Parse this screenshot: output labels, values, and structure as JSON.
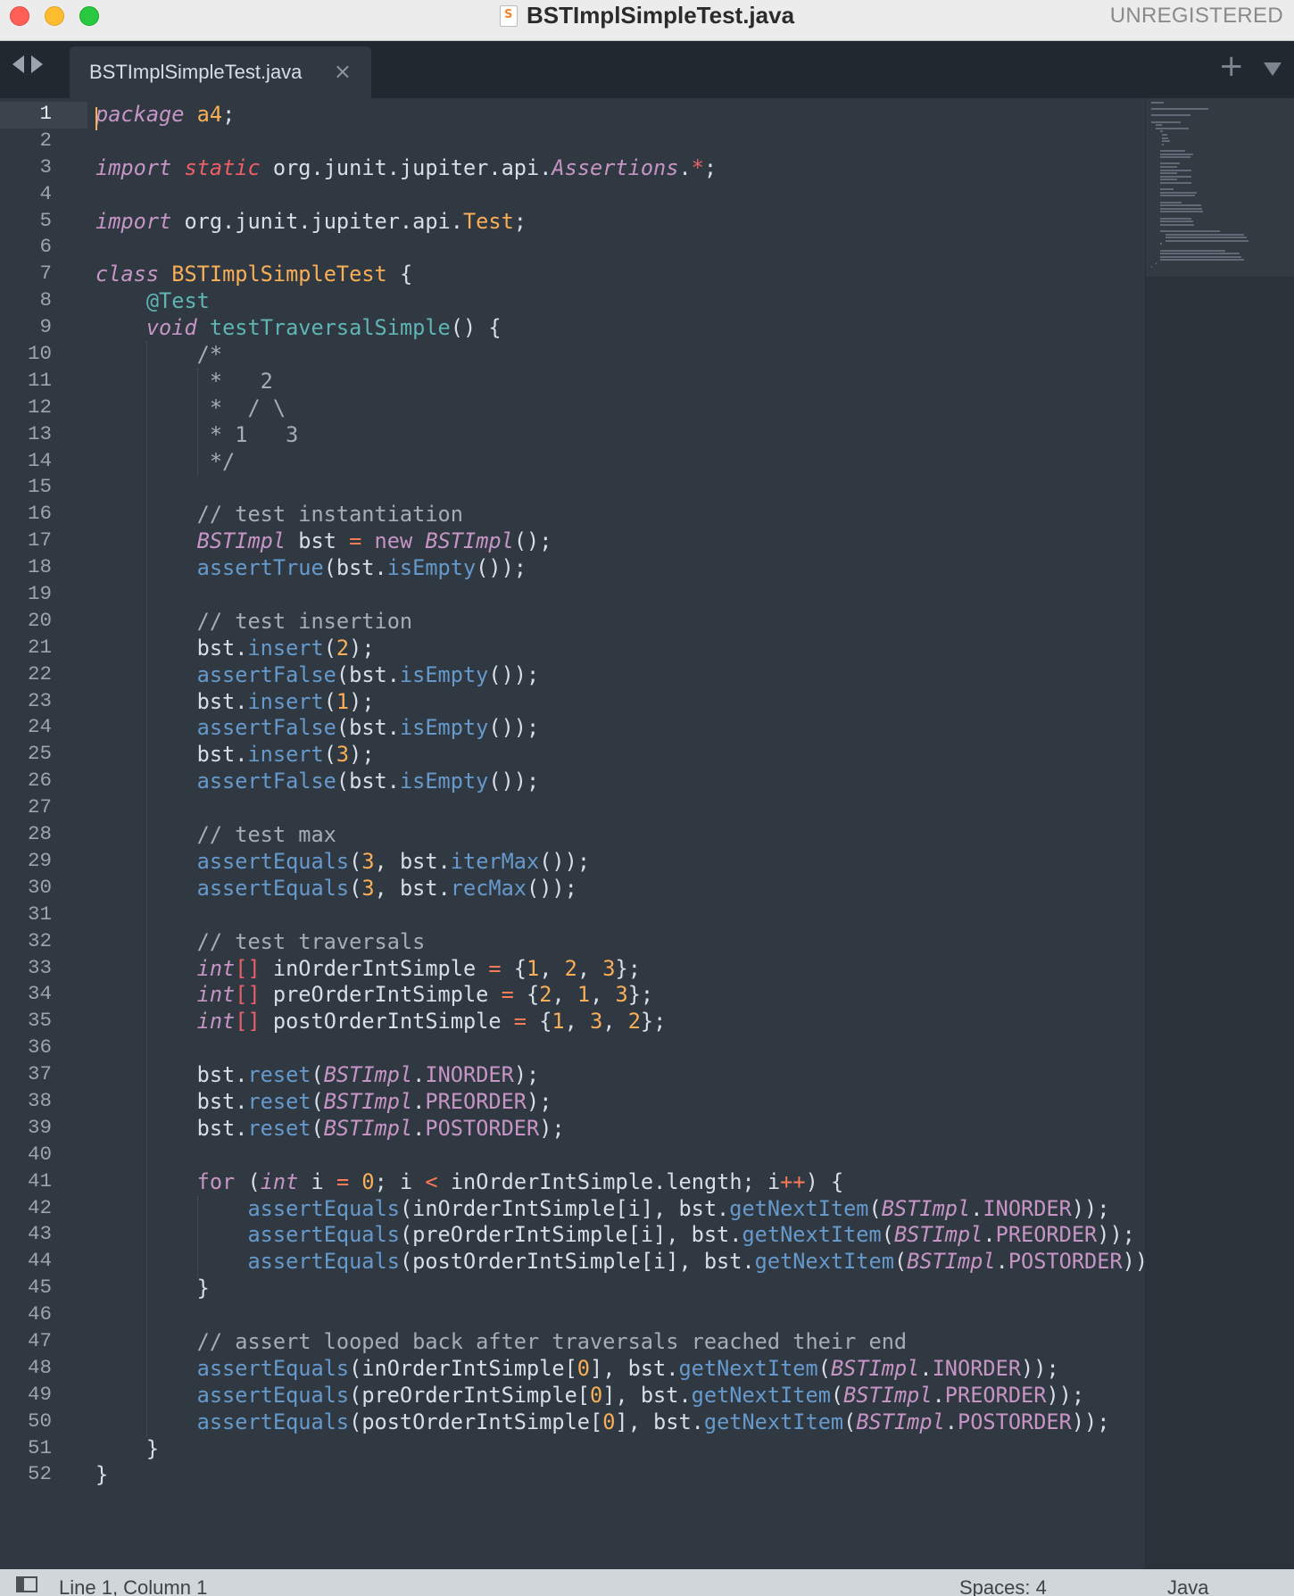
{
  "window": {
    "title": "BSTImplSimpleTest.java",
    "license_status": "UNREGISTERED",
    "file_icon": "sublime-file-icon"
  },
  "tabs": [
    {
      "label": "BSTImplSimpleTest.java",
      "active": true
    }
  ],
  "tab_bar": {
    "close_glyph": "×",
    "new_tab_glyph": "+"
  },
  "editor": {
    "current_line": 1,
    "line_numbers": [
      "1",
      "2",
      "3",
      "4",
      "5",
      "6",
      "7",
      "8",
      "9",
      "10",
      "11",
      "12",
      "13",
      "14",
      "15",
      "16",
      "17",
      "18",
      "19",
      "20",
      "21",
      "22",
      "23",
      "24",
      "25",
      "26",
      "27",
      "28",
      "29",
      "30",
      "31",
      "32",
      "33",
      "34",
      "35",
      "36",
      "37",
      "38",
      "39",
      "40",
      "41",
      "42",
      "43",
      "44",
      "45",
      "46",
      "47",
      "48",
      "49",
      "50",
      "51",
      "52"
    ],
    "lines": [
      [
        [
          "kw",
          "package"
        ],
        [
          "pu",
          " "
        ],
        [
          "ty",
          "a4"
        ],
        [
          "pu",
          ";"
        ]
      ],
      [],
      [
        [
          "kw",
          "import"
        ],
        [
          "pu",
          " "
        ],
        [
          "sc",
          "static"
        ],
        [
          "pu",
          " org.junit.jupiter.api."
        ],
        [
          "cls",
          "Assertions"
        ],
        [
          "pu",
          "."
        ],
        [
          "lt",
          "*"
        ],
        [
          "pu",
          ";"
        ]
      ],
      [],
      [
        [
          "kw",
          "import"
        ],
        [
          "pu",
          " org.junit.jupiter.api."
        ],
        [
          "ty",
          "Test"
        ],
        [
          "pu",
          ";"
        ]
      ],
      [],
      [
        [
          "kw",
          "class"
        ],
        [
          "pu",
          " "
        ],
        [
          "ty",
          "BSTImplSimpleTest"
        ],
        [
          "pu",
          " {"
        ]
      ],
      [
        [
          "pu",
          "    "
        ],
        [
          "an",
          "@Test"
        ]
      ],
      [
        [
          "pu",
          "    "
        ],
        [
          "kw",
          "void"
        ],
        [
          "pu",
          " "
        ],
        [
          "an",
          "testTraversalSimple"
        ],
        [
          "pu",
          "() {"
        ]
      ],
      [
        [
          "pu",
          "        "
        ],
        [
          "cm",
          "/*"
        ]
      ],
      [
        [
          "pu",
          "        "
        ],
        [
          "cm",
          " *   2"
        ]
      ],
      [
        [
          "pu",
          "        "
        ],
        [
          "cm",
          " *  / \\"
        ]
      ],
      [
        [
          "pu",
          "        "
        ],
        [
          "cm",
          " * 1   3"
        ]
      ],
      [
        [
          "pu",
          "        "
        ],
        [
          "cm",
          " */"
        ]
      ],
      [],
      [
        [
          "pu",
          "        "
        ],
        [
          "cm",
          "// test instantiation"
        ]
      ],
      [
        [
          "pu",
          "        "
        ],
        [
          "cls",
          "BSTImpl"
        ],
        [
          "pu",
          " bst "
        ],
        [
          "op",
          "="
        ],
        [
          "pu",
          " "
        ],
        [
          "cn",
          "new"
        ],
        [
          "pu",
          " "
        ],
        [
          "cls",
          "BSTImpl"
        ],
        [
          "pu",
          "();"
        ]
      ],
      [
        [
          "pu",
          "        "
        ],
        [
          "fn",
          "assertTrue"
        ],
        [
          "pu",
          "(bst."
        ],
        [
          "fn",
          "isEmpty"
        ],
        [
          "pu",
          "());"
        ]
      ],
      [],
      [
        [
          "pu",
          "        "
        ],
        [
          "cm",
          "// test insertion"
        ]
      ],
      [
        [
          "pu",
          "        bst."
        ],
        [
          "fn",
          "insert"
        ],
        [
          "pu",
          "("
        ],
        [
          "nm",
          "2"
        ],
        [
          "pu",
          ");"
        ]
      ],
      [
        [
          "pu",
          "        "
        ],
        [
          "fn",
          "assertFalse"
        ],
        [
          "pu",
          "(bst."
        ],
        [
          "fn",
          "isEmpty"
        ],
        [
          "pu",
          "());"
        ]
      ],
      [
        [
          "pu",
          "        bst."
        ],
        [
          "fn",
          "insert"
        ],
        [
          "pu",
          "("
        ],
        [
          "nm",
          "1"
        ],
        [
          "pu",
          ");"
        ]
      ],
      [
        [
          "pu",
          "        "
        ],
        [
          "fn",
          "assertFalse"
        ],
        [
          "pu",
          "(bst."
        ],
        [
          "fn",
          "isEmpty"
        ],
        [
          "pu",
          "());"
        ]
      ],
      [
        [
          "pu",
          "        bst."
        ],
        [
          "fn",
          "insert"
        ],
        [
          "pu",
          "("
        ],
        [
          "nm",
          "3"
        ],
        [
          "pu",
          ");"
        ]
      ],
      [
        [
          "pu",
          "        "
        ],
        [
          "fn",
          "assertFalse"
        ],
        [
          "pu",
          "(bst."
        ],
        [
          "fn",
          "isEmpty"
        ],
        [
          "pu",
          "());"
        ]
      ],
      [],
      [
        [
          "pu",
          "        "
        ],
        [
          "cm",
          "// test max"
        ]
      ],
      [
        [
          "pu",
          "        "
        ],
        [
          "fn",
          "assertEquals"
        ],
        [
          "pu",
          "("
        ],
        [
          "nm",
          "3"
        ],
        [
          "pu",
          ", bst."
        ],
        [
          "fn",
          "iterMax"
        ],
        [
          "pu",
          "());"
        ]
      ],
      [
        [
          "pu",
          "        "
        ],
        [
          "fn",
          "assertEquals"
        ],
        [
          "pu",
          "("
        ],
        [
          "nm",
          "3"
        ],
        [
          "pu",
          ", bst."
        ],
        [
          "fn",
          "recMax"
        ],
        [
          "pu",
          "());"
        ]
      ],
      [],
      [
        [
          "pu",
          "        "
        ],
        [
          "cm",
          "// test traversals"
        ]
      ],
      [
        [
          "pu",
          "        "
        ],
        [
          "kw",
          "int"
        ],
        [
          "lt",
          "[]"
        ],
        [
          "pu",
          " inOrderIntSimple "
        ],
        [
          "op",
          "="
        ],
        [
          "pu",
          " {"
        ],
        [
          "nm",
          "1"
        ],
        [
          "pu",
          ", "
        ],
        [
          "nm",
          "2"
        ],
        [
          "pu",
          ", "
        ],
        [
          "nm",
          "3"
        ],
        [
          "pu",
          "};"
        ]
      ],
      [
        [
          "pu",
          "        "
        ],
        [
          "kw",
          "int"
        ],
        [
          "lt",
          "[]"
        ],
        [
          "pu",
          " preOrderIntSimple "
        ],
        [
          "op",
          "="
        ],
        [
          "pu",
          " {"
        ],
        [
          "nm",
          "2"
        ],
        [
          "pu",
          ", "
        ],
        [
          "nm",
          "1"
        ],
        [
          "pu",
          ", "
        ],
        [
          "nm",
          "3"
        ],
        [
          "pu",
          "};"
        ]
      ],
      [
        [
          "pu",
          "        "
        ],
        [
          "kw",
          "int"
        ],
        [
          "lt",
          "[]"
        ],
        [
          "pu",
          " postOrderIntSimple "
        ],
        [
          "op",
          "="
        ],
        [
          "pu",
          " {"
        ],
        [
          "nm",
          "1"
        ],
        [
          "pu",
          ", "
        ],
        [
          "nm",
          "3"
        ],
        [
          "pu",
          ", "
        ],
        [
          "nm",
          "2"
        ],
        [
          "pu",
          "};"
        ]
      ],
      [],
      [
        [
          "pu",
          "        bst."
        ],
        [
          "fn",
          "reset"
        ],
        [
          "pu",
          "("
        ],
        [
          "cls",
          "BSTImpl"
        ],
        [
          "pu",
          "."
        ],
        [
          "cn",
          "INORDER"
        ],
        [
          "pu",
          ");"
        ]
      ],
      [
        [
          "pu",
          "        bst."
        ],
        [
          "fn",
          "reset"
        ],
        [
          "pu",
          "("
        ],
        [
          "cls",
          "BSTImpl"
        ],
        [
          "pu",
          "."
        ],
        [
          "cn",
          "PREORDER"
        ],
        [
          "pu",
          ");"
        ]
      ],
      [
        [
          "pu",
          "        bst."
        ],
        [
          "fn",
          "reset"
        ],
        [
          "pu",
          "("
        ],
        [
          "cls",
          "BSTImpl"
        ],
        [
          "pu",
          "."
        ],
        [
          "cn",
          "POSTORDER"
        ],
        [
          "pu",
          ");"
        ]
      ],
      [],
      [
        [
          "pu",
          "        "
        ],
        [
          "cn",
          "for"
        ],
        [
          "pu",
          " ("
        ],
        [
          "kw",
          "int"
        ],
        [
          "pu",
          " i "
        ],
        [
          "op",
          "="
        ],
        [
          "pu",
          " "
        ],
        [
          "nm",
          "0"
        ],
        [
          "pu",
          "; i "
        ],
        [
          "op",
          "<"
        ],
        [
          "pu",
          " inOrderIntSimple.length; i"
        ],
        [
          "op",
          "++"
        ],
        [
          "pu",
          ") {"
        ]
      ],
      [
        [
          "pu",
          "            "
        ],
        [
          "fn",
          "assertEquals"
        ],
        [
          "pu",
          "(inOrderIntSimple[i], bst."
        ],
        [
          "fn",
          "getNextItem"
        ],
        [
          "pu",
          "("
        ],
        [
          "cls",
          "BSTImpl"
        ],
        [
          "pu",
          "."
        ],
        [
          "cn",
          "INORDER"
        ],
        [
          "pu",
          "));"
        ]
      ],
      [
        [
          "pu",
          "            "
        ],
        [
          "fn",
          "assertEquals"
        ],
        [
          "pu",
          "(preOrderIntSimple[i], bst."
        ],
        [
          "fn",
          "getNextItem"
        ],
        [
          "pu",
          "("
        ],
        [
          "cls",
          "BSTImpl"
        ],
        [
          "pu",
          "."
        ],
        [
          "cn",
          "PREORDER"
        ],
        [
          "pu",
          "));"
        ]
      ],
      [
        [
          "pu",
          "            "
        ],
        [
          "fn",
          "assertEquals"
        ],
        [
          "pu",
          "(postOrderIntSimple[i], bst."
        ],
        [
          "fn",
          "getNextItem"
        ],
        [
          "pu",
          "("
        ],
        [
          "cls",
          "BSTImpl"
        ],
        [
          "pu",
          "."
        ],
        [
          "cn",
          "POSTORDER"
        ],
        [
          "pu",
          "));"
        ]
      ],
      [
        [
          "pu",
          "        }"
        ]
      ],
      [],
      [
        [
          "pu",
          "        "
        ],
        [
          "cm",
          "// assert looped back after traversals reached their end"
        ]
      ],
      [
        [
          "pu",
          "        "
        ],
        [
          "fn",
          "assertEquals"
        ],
        [
          "pu",
          "(inOrderIntSimple["
        ],
        [
          "nm",
          "0"
        ],
        [
          "pu",
          "], bst."
        ],
        [
          "fn",
          "getNextItem"
        ],
        [
          "pu",
          "("
        ],
        [
          "cls",
          "BSTImpl"
        ],
        [
          "pu",
          "."
        ],
        [
          "cn",
          "INORDER"
        ],
        [
          "pu",
          "));"
        ]
      ],
      [
        [
          "pu",
          "        "
        ],
        [
          "fn",
          "assertEquals"
        ],
        [
          "pu",
          "(preOrderIntSimple["
        ],
        [
          "nm",
          "0"
        ],
        [
          "pu",
          "], bst."
        ],
        [
          "fn",
          "getNextItem"
        ],
        [
          "pu",
          "("
        ],
        [
          "cls",
          "BSTImpl"
        ],
        [
          "pu",
          "."
        ],
        [
          "cn",
          "PREORDER"
        ],
        [
          "pu",
          "));"
        ]
      ],
      [
        [
          "pu",
          "        "
        ],
        [
          "fn",
          "assertEquals"
        ],
        [
          "pu",
          "(postOrderIntSimple["
        ],
        [
          "nm",
          "0"
        ],
        [
          "pu",
          "], bst."
        ],
        [
          "fn",
          "getNextItem"
        ],
        [
          "pu",
          "("
        ],
        [
          "cls",
          "BSTImpl"
        ],
        [
          "pu",
          "."
        ],
        [
          "cn",
          "POSTORDER"
        ],
        [
          "pu",
          "));"
        ]
      ],
      [
        [
          "pu",
          "    }"
        ]
      ],
      [
        [
          "pu",
          "}"
        ]
      ]
    ]
  },
  "statusbar": {
    "position": "Line 1, Column 1",
    "indentation": "Spaces: 4",
    "syntax": "Java"
  },
  "colors": {
    "background": "#303841",
    "keyword": "#c695c6",
    "type": "#f9ae58",
    "function": "#6699cc",
    "comment": "#a6acb9",
    "annotation": "#5fb4b4",
    "caret": "#f9ae58"
  }
}
